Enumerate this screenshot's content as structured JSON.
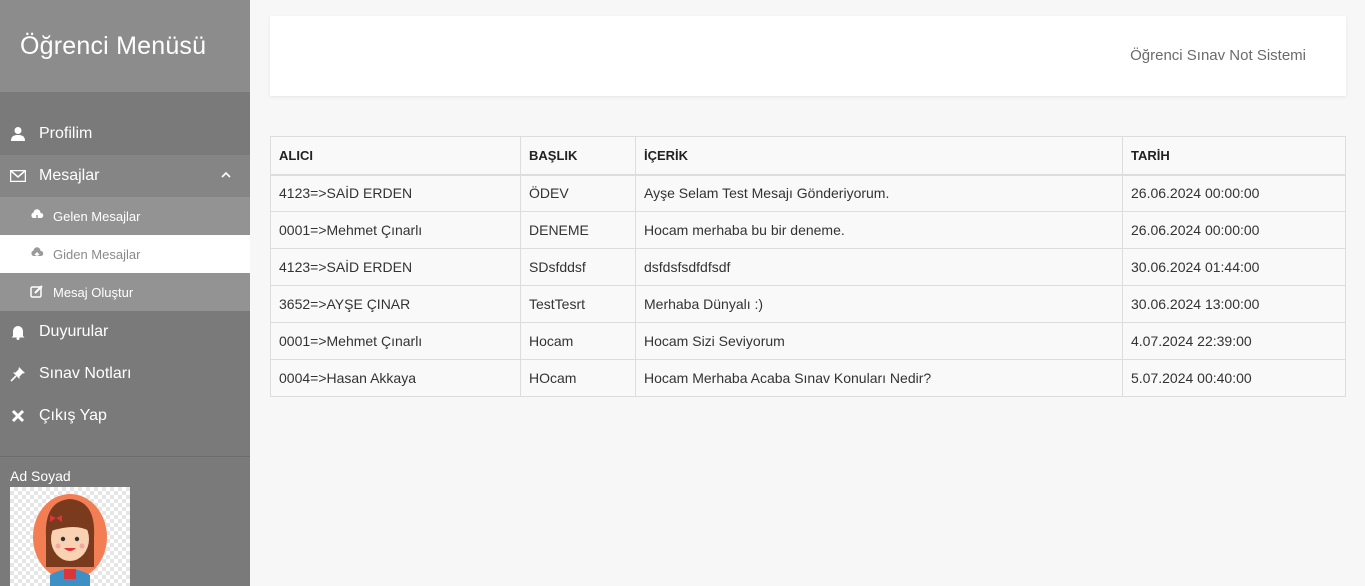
{
  "sidebar": {
    "title": "Öğrenci Menüsü",
    "menu": [
      {
        "label": "Profilim",
        "icon": "user-icon"
      },
      {
        "label": "Mesajlar",
        "icon": "envelope-icon"
      },
      {
        "label": "Duyurular",
        "icon": "bell-icon"
      },
      {
        "label": "Sınav Notları",
        "icon": "pushpin-icon"
      },
      {
        "label": "Çıkış Yap",
        "icon": "close-icon"
      }
    ],
    "messages_submenu": [
      {
        "label": "Gelen Mesajlar",
        "icon": "cloud-download-icon"
      },
      {
        "label": "Giden Mesajlar",
        "icon": "cloud-upload-icon"
      },
      {
        "label": "Mesaj Oluştur",
        "icon": "edit-icon"
      }
    ],
    "profile_name": "Ad Soyad"
  },
  "header": {
    "title": "Öğrenci Sınav Not Sistemi"
  },
  "table": {
    "columns": [
      "ALICI",
      "BAŞLIK",
      "İÇERİK",
      "TARİH"
    ],
    "rows": [
      [
        "4123=>SAİD ERDEN",
        "ÖDEV",
        "Ayşe Selam Test Mesajı Gönderiyorum.",
        "26.06.2024 00:00:00"
      ],
      [
        "0001=>Mehmet Çınarlı",
        "DENEME",
        "Hocam merhaba bu bir deneme.",
        "26.06.2024 00:00:00"
      ],
      [
        "4123=>SAİD ERDEN",
        "SDsfddsf",
        "dsfdsfsdfdfsdf",
        "30.06.2024 01:44:00"
      ],
      [
        "3652=>AYŞE ÇINAR",
        "TestTesrt",
        "Merhaba Dünyalı :)",
        "30.06.2024 13:00:00"
      ],
      [
        "0001=>Mehmet Çınarlı",
        "Hocam",
        "Hocam Sizi Seviyorum",
        "4.07.2024 22:39:00"
      ],
      [
        "0004=>Hasan Akkaya",
        "HOcam",
        "Hocam Merhaba Acaba Sınav Konuları Nedir?",
        "5.07.2024 00:40:00"
      ]
    ]
  },
  "colors": {
    "sidebar_bg": "#7a7a7a",
    "sidebar_header_bg": "#8c8c8c",
    "active_item_bg": "#ffffff"
  }
}
